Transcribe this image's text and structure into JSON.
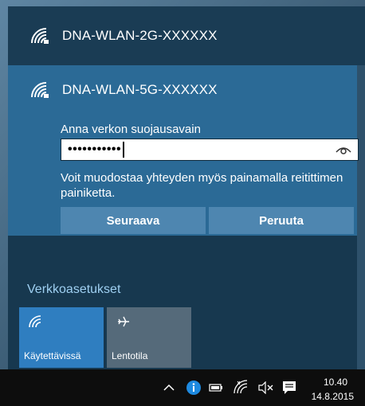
{
  "networks": [
    {
      "ssid": "DNA-WLAN-2G-XXXXXX",
      "icon": "wifi-secured-icon"
    },
    {
      "ssid": "DNA-WLAN-5G-XXXXXX",
      "icon": "wifi-secured-icon"
    }
  ],
  "connect_form": {
    "label": "Anna verkon suojausavain",
    "password_masked": "•••••••••••",
    "reveal_icon": "eye-icon",
    "hint": "Voit muodostaa yhteyden myös painamalla reitittimen painiketta.",
    "next_label": "Seuraava",
    "cancel_label": "Peruuta"
  },
  "settings_link": "Verkkoasetukset",
  "quick_actions": [
    {
      "label": "Käytettävissä",
      "icon": "wifi-icon",
      "active": true
    },
    {
      "label": "Lentotila",
      "icon": "airplane-icon",
      "active": false
    }
  ],
  "taskbar": {
    "time": "10.40",
    "date": "14.8.2015",
    "icons": [
      "chevron-up-icon",
      "info-icon",
      "battery-icon",
      "wifi-icon",
      "volume-mute-icon",
      "action-center-icon"
    ]
  },
  "colors": {
    "panel": "#17384f",
    "selected_network": "#2b6a96",
    "button": "#4e86b0",
    "link": "#9fd0f2",
    "tile_active": "#2f7ec0",
    "tile_inactive": "#556a7a",
    "taskbar": "#0d0d0d"
  }
}
